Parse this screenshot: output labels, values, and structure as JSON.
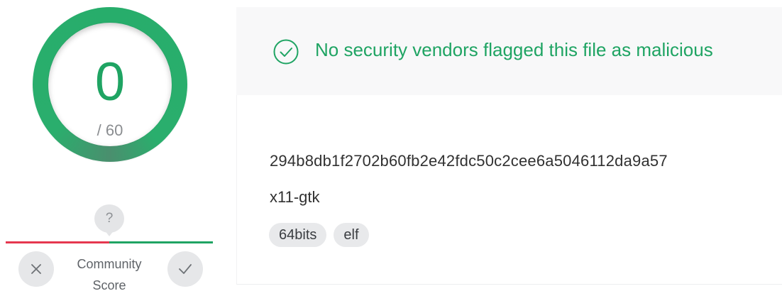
{
  "score": {
    "detected": "0",
    "total": "/ 60"
  },
  "community": {
    "unknown_mark": "?",
    "label_line1": "Community",
    "label_line2": "Score"
  },
  "status": {
    "message": "No security vendors flagged this file as malicious",
    "icon": "check-circle-icon",
    "color": "#1fa463"
  },
  "file": {
    "hash": "294b8db1f2702b60fb2e42fdc50c2cee6a5046112da9a57",
    "name": "x11-gtk",
    "tags": [
      "64bits",
      "elf"
    ]
  },
  "colors": {
    "accent": "#1fa463",
    "negative": "#e5374f"
  }
}
